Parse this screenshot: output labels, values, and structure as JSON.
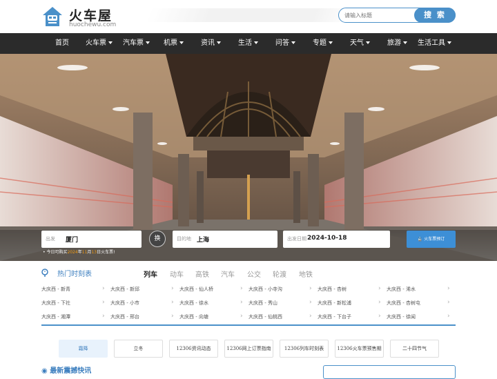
{
  "brand": {
    "title": "火车屋",
    "subtitle": "huochewu.com"
  },
  "search": {
    "placeholder": "请输入标题",
    "button": "搜 索"
  },
  "nav": [
    {
      "label": "首页",
      "dropdown": false
    },
    {
      "label": "火车票",
      "dropdown": true
    },
    {
      "label": "汽车票",
      "dropdown": true
    },
    {
      "label": "机票",
      "dropdown": true
    },
    {
      "label": "资讯",
      "dropdown": true
    },
    {
      "label": "生活",
      "dropdown": true
    },
    {
      "label": "问答",
      "dropdown": true
    },
    {
      "label": "专题",
      "dropdown": true
    },
    {
      "label": "天气",
      "dropdown": true
    },
    {
      "label": "旅游",
      "dropdown": true
    },
    {
      "label": "生活工具",
      "dropdown": true
    }
  ],
  "booking": {
    "from_label": "出发",
    "from_value": "厦门",
    "swap_label": "换",
    "to_label": "目的地",
    "to_value": "上海",
    "date_label": "出发日期",
    "date_value": "2024-10-18",
    "button": "火车票预订",
    "notice_prefix": "今日可购买",
    "notice_year": "2024",
    "notice_mid1": "年",
    "notice_month": "11",
    "notice_mid2": "月",
    "notice_day": "13",
    "notice_suffix": "日火车票!"
  },
  "timetable": {
    "title": "热门时刻表",
    "tabs": [
      "列车",
      "动车",
      "高铁",
      "汽车",
      "公交",
      "轮渡",
      "地铁"
    ],
    "rows": [
      [
        "大庆西 - 新青",
        "大庆西 - 新邱",
        "大庆西 - 仙人桥",
        "大庆西 - 小寺沟",
        "大庆西 - 杏树",
        "大庆西 - 浠水"
      ],
      [
        "大庆西 - 下社",
        "大庆西 - 小市",
        "大庆西 - 徐水",
        "大庆西 - 秀山",
        "大庆西 - 新松浦",
        "大庆西 - 杏树屯"
      ],
      [
        "大庆西 - 湘潭",
        "大庆西 - 邢台",
        "大庆西 - 向塘",
        "大庆西 - 仙桃西",
        "大庆西 - 下台子",
        "大庆西 - 徐闻"
      ]
    ]
  },
  "quick_links": [
    "霜降",
    "立冬",
    "12306资讯动态",
    "12306网上订票指南",
    "12306列车时刻表",
    "12306火车票预售期",
    "二十四节气"
  ],
  "news": {
    "title": "最新震撼快讯"
  },
  "colors": {
    "accent": "#3d8fd6",
    "nav_bg": "#2b2b2b",
    "highlight": "#f39c12"
  }
}
